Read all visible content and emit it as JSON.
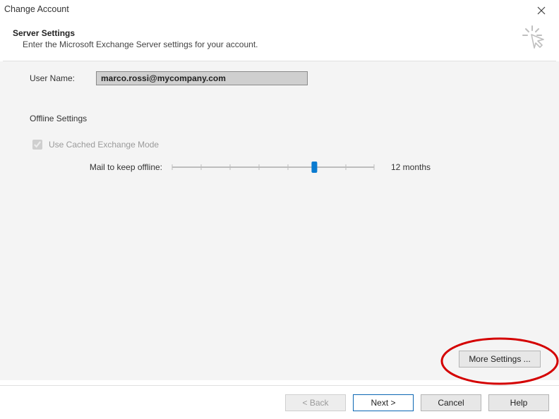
{
  "title": "Change Account",
  "header": {
    "heading": "Server Settings",
    "subheading": "Enter the Microsoft Exchange Server settings for your account."
  },
  "user": {
    "label": "User Name:",
    "value": "marco.rossi@mycompany.com"
  },
  "offline": {
    "section_title": "Offline Settings",
    "cached_label": "Use Cached Exchange Mode",
    "cached_checked": true,
    "slider_label": "Mail to keep offline:",
    "slider_value_label": "12 months",
    "slider_position": 0.71
  },
  "more_settings_label": "More Settings ...",
  "footer": {
    "back": "< Back",
    "next": "Next >",
    "cancel": "Cancel",
    "help": "Help"
  },
  "annotation": {
    "ellipse_color": "#d40000"
  }
}
